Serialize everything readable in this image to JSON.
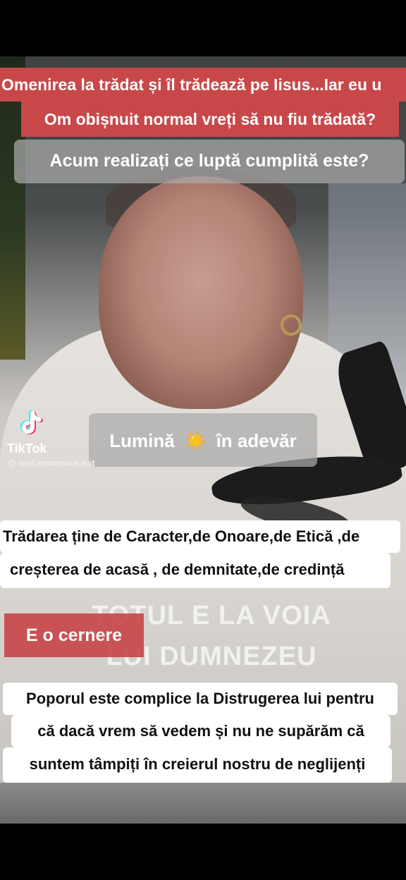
{
  "captions": {
    "top_line1": "Omenirea la trădat și  îl trădează pe Iisus...Iar eu u",
    "top_line2": "Om obișnuit normal vreți să nu fiu trădată?",
    "gray_top": "Acum realizați ce luptă cumplită este?",
    "light_pre": "Lumină",
    "light_post": "în adevăr",
    "sun_emoji": "☀️",
    "betrayal_line1": "Trădarea ține de Caracter,de Onoare,de Etică ,de",
    "betrayal_line2": "creșterea de acasă , de demnitate,de credință",
    "sieve": "E o cernere",
    "people_line1": "Poporul este complice la Distrugerea lui pentru",
    "people_line2": "că dacă vrem să vedem și nu ne supărăm că",
    "people_line3": "suntem tâmpiți în creierul nostru de neglijenți"
  },
  "video_overlay": {
    "line1": "TOTUL E LA VOIA",
    "line2": "LUI DUMNEZEU"
  },
  "watermark": {
    "brand": "TikTok",
    "handle": "@ real.romanian.nat",
    "icon": "tiktok-logo-icon"
  },
  "colors": {
    "red_caption": "#c8484a",
    "gray_caption": "#aaaaaa",
    "white_caption": "#ffffff",
    "tiktok_cyan": "#25f4ee",
    "tiktok_pink": "#fe2c55"
  }
}
